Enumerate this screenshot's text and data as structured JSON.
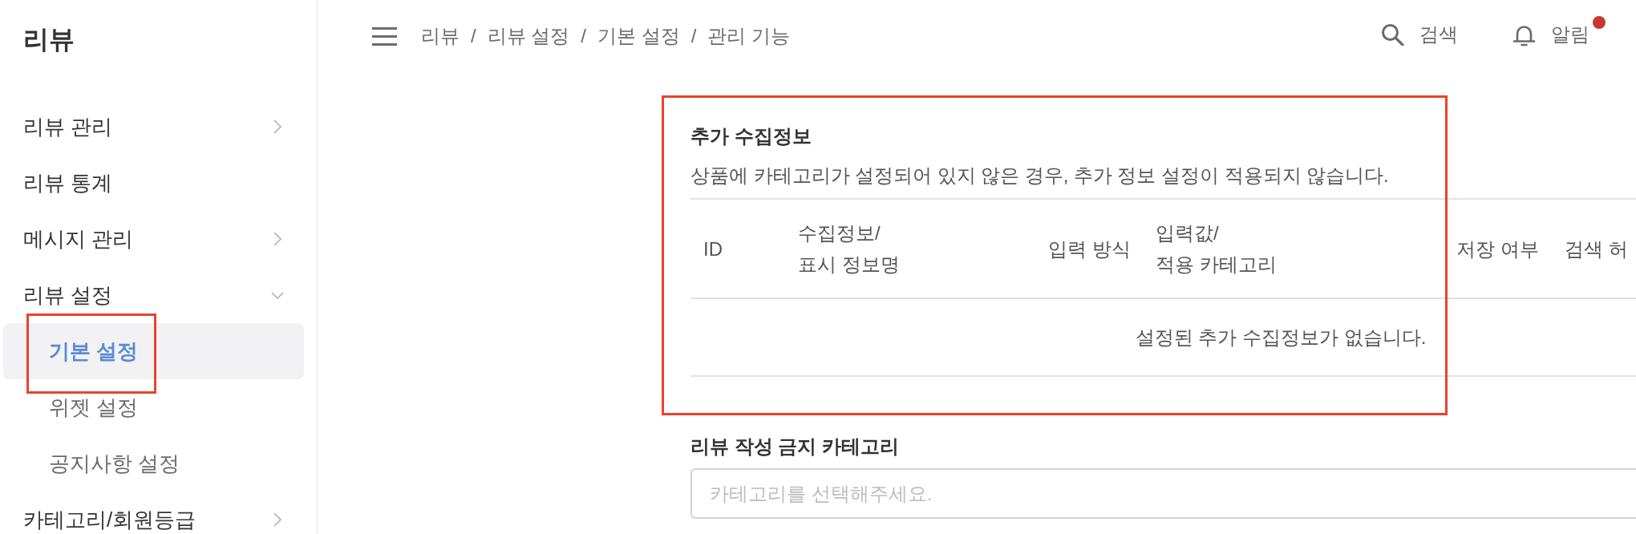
{
  "sidebar": {
    "title": "리뷰",
    "items": [
      {
        "label": "리뷰 관리",
        "kind": "group",
        "expanded": false,
        "highlighted": false
      },
      {
        "label": "리뷰 통계",
        "kind": "link",
        "highlighted": false
      },
      {
        "label": "메시지 관리",
        "kind": "group",
        "expanded": false,
        "highlighted": false
      },
      {
        "label": "리뷰 설정",
        "kind": "group",
        "expanded": true,
        "highlighted": false,
        "children": [
          {
            "label": "기본 설정",
            "selected": true,
            "highlighted": true
          },
          {
            "label": "위젯 설정",
            "selected": false,
            "highlighted": false
          },
          {
            "label": "공지사항 설정",
            "selected": false,
            "highlighted": false
          }
        ]
      },
      {
        "label": "카테고리/회원등급",
        "kind": "group",
        "expanded": false,
        "highlighted": false
      }
    ]
  },
  "header": {
    "breadcrumb": {
      "separator": "/",
      "items": [
        "리뷰",
        "리뷰 설정",
        "기본 설정",
        "관리 기능"
      ]
    },
    "actions": [
      {
        "kind": "search",
        "label": "검색"
      },
      {
        "kind": "notifications",
        "label": "알림",
        "unread": true
      }
    ]
  },
  "sections": [
    {
      "kind": "table",
      "title": "추가 수집정보",
      "description": "상품에 카테고리가 설정되어 있지 않은 경우, 추가 정보 설정이 적용되지 않습니다.",
      "highlighted": true,
      "columns": [
        {
          "lines": [
            "ID"
          ]
        },
        {
          "lines": [
            "수집정보/",
            "표시 정보명"
          ]
        },
        {
          "lines": [
            "입력 방식"
          ]
        },
        {
          "lines": [
            "입력값/",
            "적용 카테고리"
          ]
        },
        {
          "lines": [
            "저장 여부"
          ]
        },
        {
          "lines": [
            "검색 허"
          ]
        }
      ],
      "empty_message": "설정된 추가 수집정보가 없습니다."
    },
    {
      "kind": "select",
      "title": "리뷰 작성 금지 카테고리",
      "placeholder": "카테고리를 선택해주세요.",
      "highlighted": false
    }
  ]
}
